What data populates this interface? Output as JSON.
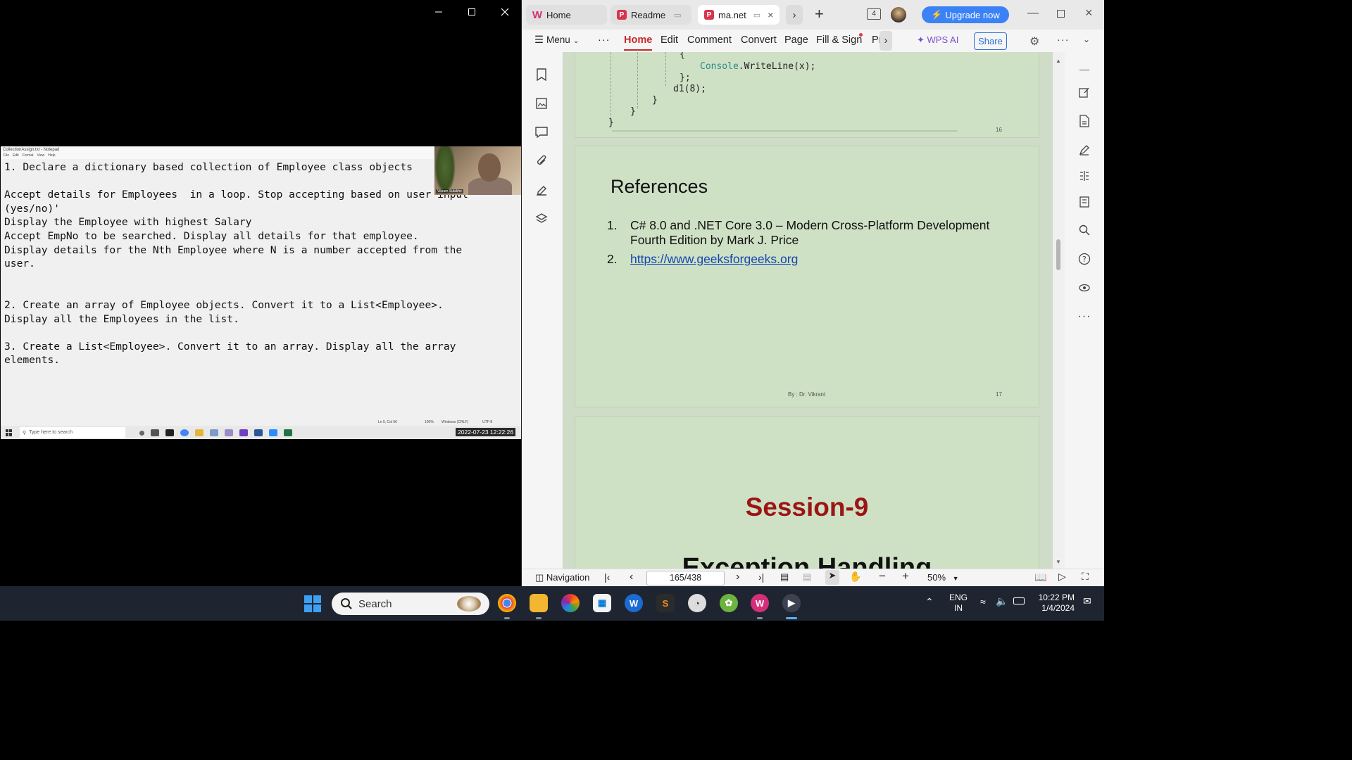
{
  "notepad": {
    "title": "CollectionAssign.txt - Notepad",
    "menu": [
      "File",
      "Edit",
      "Format",
      "View",
      "Help"
    ],
    "lines": [
      "1. Declare a dictionary based collection of Employee class objects",
      "",
      "Accept details for Employees  in a loop. Stop accepting based on user input",
      "(yes/no)'",
      "Display the Employee with highest Salary",
      "Accept EmpNo to be searched. Display all details for that employee.",
      "Display details for the Nth Employee where N is a number accepted from the",
      "user.",
      "",
      "",
      "2. Create an array of Employee objects. Convert it to a List<Employee>.",
      "Display all the Employees in the list.",
      "",
      "3. Create a List<Employee>. Convert it to an array. Display all the array",
      "elements."
    ],
    "status": {
      "position": "Ln 5, Col 56",
      "zoom": "100%",
      "line_ending": "Windows (CRLF)",
      "encoding": "UTF-8"
    }
  },
  "presenter": {
    "name": "Vikram Sulakhe"
  },
  "shared_taskbar": {
    "search_placeholder": "Type here to search",
    "datetime": "2022-07-23 12:22:26"
  },
  "wps": {
    "tabs": [
      {
        "label": "Home"
      },
      {
        "label": "Readme"
      },
      {
        "label": "ma.net"
      }
    ],
    "tab_count_badge": "4",
    "upgrade_label": "Upgrade now",
    "menu": {
      "menu_label": "Menu",
      "items": [
        "Home",
        "Edit",
        "Comment",
        "Convert",
        "Page",
        "Fill & Sign",
        "Pr"
      ],
      "wps_ai": "WPS AI",
      "share": "Share"
    },
    "document": {
      "code_lines": [
        "{",
        "Console.WriteLine(x);",
        "};",
        "d1(8);",
        "}",
        "}",
        "}"
      ],
      "code_keyword": "Console",
      "page_16_number": "16",
      "references_title": "References",
      "references": [
        {
          "num": "1.",
          "text": "C# 8.0 and .NET Core 3.0 – Modern Cross-Platform Development Fourth Edition by Mark J. Price"
        },
        {
          "num": "2.",
          "text": "https://www.geeksforgeeks.org"
        }
      ],
      "footer_author": "By : Dr. Vikrant",
      "page_17_number": "17",
      "session_title": "Session-9",
      "next_title": "Exception Handling"
    },
    "status": {
      "navigation": "Navigation",
      "page": "165/438",
      "zoom": "50%"
    }
  },
  "taskbar": {
    "search_label": "Search",
    "language": "ENG",
    "region": "IN",
    "time": "10:22 PM",
    "date": "1/4/2024"
  },
  "colors": {
    "wps_accent": "#c62828",
    "upgrade_blue": "#3b82f6",
    "page_bg": "#cfe1c5",
    "session_red": "#9b1515",
    "link_blue": "#1446b0"
  }
}
